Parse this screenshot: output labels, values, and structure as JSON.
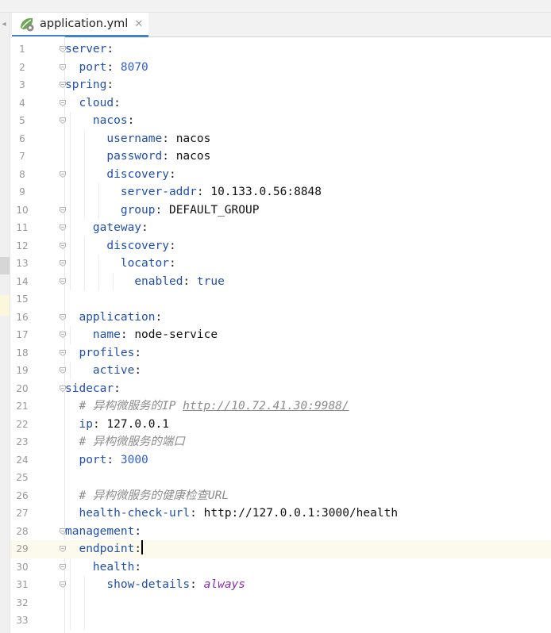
{
  "tab": {
    "label": "application.yml",
    "file_icon": "spring-leaf-yaml-icon",
    "close_icon": "close-icon"
  },
  "caret_line": 29,
  "lines": [
    [
      {
        "t": "k",
        "v": "server"
      },
      {
        "t": "p",
        "v": ":"
      }
    ],
    [
      {
        "t": "sp",
        "v": "  "
      },
      {
        "t": "k",
        "v": "port"
      },
      {
        "t": "p",
        "v": ": "
      },
      {
        "t": "num",
        "v": "8070"
      }
    ],
    [
      {
        "t": "k",
        "v": "spring"
      },
      {
        "t": "p",
        "v": ":"
      }
    ],
    [
      {
        "t": "sp",
        "v": "  "
      },
      {
        "t": "k",
        "v": "cloud"
      },
      {
        "t": "p",
        "v": ":"
      }
    ],
    [
      {
        "t": "sp",
        "v": "    "
      },
      {
        "t": "k",
        "v": "nacos"
      },
      {
        "t": "p",
        "v": ":"
      }
    ],
    [
      {
        "t": "sp",
        "v": "      "
      },
      {
        "t": "k",
        "v": "username"
      },
      {
        "t": "p",
        "v": ": "
      },
      {
        "t": "s",
        "v": "nacos"
      }
    ],
    [
      {
        "t": "sp",
        "v": "      "
      },
      {
        "t": "k",
        "v": "password"
      },
      {
        "t": "p",
        "v": ": "
      },
      {
        "t": "s",
        "v": "nacos"
      }
    ],
    [
      {
        "t": "sp",
        "v": "      "
      },
      {
        "t": "k",
        "v": "discovery"
      },
      {
        "t": "p",
        "v": ":"
      }
    ],
    [
      {
        "t": "sp",
        "v": "        "
      },
      {
        "t": "k",
        "v": "server-addr"
      },
      {
        "t": "p",
        "v": ": "
      },
      {
        "t": "s",
        "v": "10.133.0.56:8848"
      }
    ],
    [
      {
        "t": "sp",
        "v": "        "
      },
      {
        "t": "k",
        "v": "group"
      },
      {
        "t": "p",
        "v": ": "
      },
      {
        "t": "s",
        "v": "DEFAULT_GROUP"
      }
    ],
    [
      {
        "t": "sp",
        "v": "    "
      },
      {
        "t": "k",
        "v": "gateway"
      },
      {
        "t": "p",
        "v": ":"
      }
    ],
    [
      {
        "t": "sp",
        "v": "      "
      },
      {
        "t": "k",
        "v": "discovery"
      },
      {
        "t": "p",
        "v": ":"
      }
    ],
    [
      {
        "t": "sp",
        "v": "        "
      },
      {
        "t": "k",
        "v": "locator"
      },
      {
        "t": "p",
        "v": ":"
      }
    ],
    [
      {
        "t": "sp",
        "v": "          "
      },
      {
        "t": "k",
        "v": "enabled"
      },
      {
        "t": "p",
        "v": ": "
      },
      {
        "t": "bool",
        "v": "true"
      }
    ],
    [],
    [
      {
        "t": "sp",
        "v": "  "
      },
      {
        "t": "k",
        "v": "application"
      },
      {
        "t": "p",
        "v": ":"
      }
    ],
    [
      {
        "t": "sp",
        "v": "    "
      },
      {
        "t": "k",
        "v": "name"
      },
      {
        "t": "p",
        "v": ": "
      },
      {
        "t": "s",
        "v": "node-service"
      }
    ],
    [
      {
        "t": "sp",
        "v": "  "
      },
      {
        "t": "k",
        "v": "profiles"
      },
      {
        "t": "p",
        "v": ":"
      }
    ],
    [
      {
        "t": "sp",
        "v": "    "
      },
      {
        "t": "k",
        "v": "active"
      },
      {
        "t": "p",
        "v": ":"
      }
    ],
    [
      {
        "t": "k",
        "v": "sidecar"
      },
      {
        "t": "p",
        "v": ":"
      }
    ],
    [
      {
        "t": "sp",
        "v": "  "
      },
      {
        "t": "comment",
        "v": "# 异构微服务的IP "
      },
      {
        "t": "comment-link",
        "v": "http://10.72.41.30:9988/"
      }
    ],
    [
      {
        "t": "sp",
        "v": "  "
      },
      {
        "t": "k",
        "v": "ip"
      },
      {
        "t": "p",
        "v": ": "
      },
      {
        "t": "s",
        "v": "127.0.0.1"
      }
    ],
    [
      {
        "t": "sp",
        "v": "  "
      },
      {
        "t": "comment",
        "v": "# 异构微服务的端口"
      }
    ],
    [
      {
        "t": "sp",
        "v": "  "
      },
      {
        "t": "k",
        "v": "port"
      },
      {
        "t": "p",
        "v": ": "
      },
      {
        "t": "num",
        "v": "3000"
      }
    ],
    [],
    [
      {
        "t": "sp",
        "v": "  "
      },
      {
        "t": "comment",
        "v": "# 异构微服务的健康检查URL"
      }
    ],
    [
      {
        "t": "sp",
        "v": "  "
      },
      {
        "t": "k",
        "v": "health-check-url"
      },
      {
        "t": "p",
        "v": ": "
      },
      {
        "t": "s",
        "v": "http://127.0.0.1:3000/health"
      }
    ],
    [
      {
        "t": "k",
        "v": "management"
      },
      {
        "t": "p",
        "v": ":"
      }
    ],
    [
      {
        "t": "sp",
        "v": "  "
      },
      {
        "t": "k",
        "v": "endpoint"
      },
      {
        "t": "p",
        "v": ":"
      },
      {
        "t": "caret",
        "v": ""
      }
    ],
    [
      {
        "t": "sp",
        "v": "    "
      },
      {
        "t": "k",
        "v": "health"
      },
      {
        "t": "p",
        "v": ":"
      }
    ],
    [
      {
        "t": "sp",
        "v": "      "
      },
      {
        "t": "k",
        "v": "show-details"
      },
      {
        "t": "p",
        "v": ": "
      },
      {
        "t": "italic-val",
        "v": "always"
      }
    ],
    [],
    []
  ],
  "line_numbers": [
    "1",
    "2",
    "3",
    "4",
    "5",
    "6",
    "7",
    "8",
    "9",
    "10",
    "11",
    "12",
    "13",
    "14",
    "15",
    "16",
    "17",
    "18",
    "19",
    "20",
    "21",
    "22",
    "23",
    "24",
    "25",
    "26",
    "27",
    "28",
    "29",
    "30",
    "31",
    "32",
    "33"
  ],
  "fold_rows": [
    1,
    2,
    3,
    4,
    5,
    8,
    10,
    11,
    12,
    13,
    14,
    16,
    17,
    18,
    19,
    20,
    28,
    29,
    30,
    31
  ],
  "guides": {
    "5": [
      1
    ],
    "6": [
      1,
      2
    ],
    "7": [
      1,
      2
    ],
    "8": [
      1,
      2
    ],
    "9": [
      1,
      2,
      3
    ],
    "10": [
      1,
      2,
      3
    ],
    "11": [
      1
    ],
    "12": [
      1,
      2
    ],
    "13": [
      1,
      2,
      3
    ],
    "14": [
      1,
      2,
      3,
      4
    ],
    "17": [
      1
    ],
    "19": [
      1
    ],
    "30": [
      1
    ],
    "31": [
      1,
      2
    ],
    "32": [
      1,
      2
    ],
    "33": [
      1,
      2
    ]
  }
}
